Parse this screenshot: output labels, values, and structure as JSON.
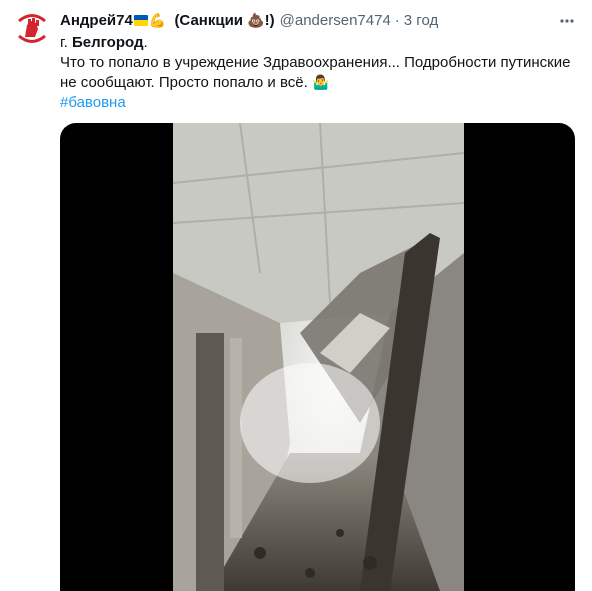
{
  "tweet": {
    "display_name": "Андрей74",
    "display_name_suffix": "(Санкции",
    "display_name_end": "!)",
    "handle": "@andersen7474",
    "separator": "·",
    "time": "3 год",
    "icons": {
      "flag": "ukraine-flag-emoji",
      "arm": "flexed-biceps-emoji",
      "poo": "pile-of-poo-emoji",
      "shrug": "person-shrugging-emoji",
      "more": "more-options-icon"
    },
    "text_line1_prefix": "г. ",
    "text_line1_bold": "Белгород",
    "text_line1_suffix": ".",
    "text_line2": "Что то попало в учреждение Здравоохранения... Подробности путинские",
    "text_line3": "не сообщают. Просто попало и всё.",
    "hashtag": "#бавовна"
  },
  "colors": {
    "accent": "#1d9bf0",
    "text": "#0f1419",
    "secondary": "#536471",
    "avatar_red": "#d5232f",
    "media_bg": "#000000"
  }
}
